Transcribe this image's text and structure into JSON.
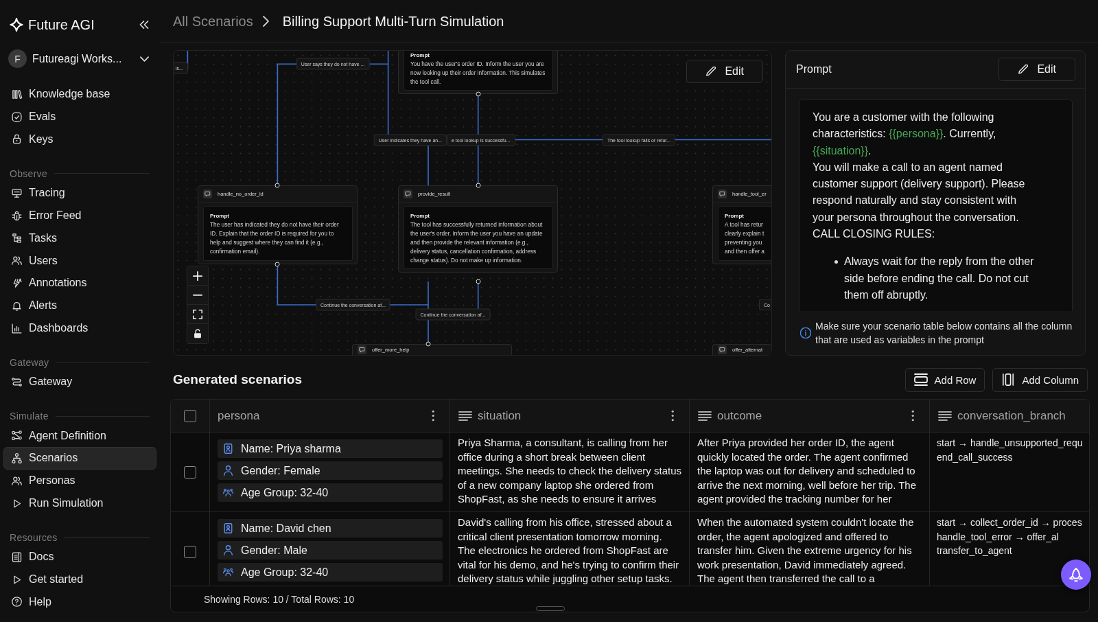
{
  "sidebar": {
    "brand": "Future AGI",
    "workspace": {
      "avatar_letter": "F",
      "name": "Futureagi Works..."
    },
    "top_items": [
      {
        "label": "Knowledge base",
        "selected": false
      },
      {
        "label": "Evals",
        "selected": false
      },
      {
        "label": "Keys",
        "selected": false
      }
    ],
    "sections": [
      {
        "title": "Observe",
        "items": [
          {
            "label": "Tracing",
            "selected": false
          },
          {
            "label": "Error Feed",
            "selected": false
          },
          {
            "label": "Tasks",
            "selected": false
          },
          {
            "label": "Users",
            "selected": false
          },
          {
            "label": "Annotations",
            "selected": false
          },
          {
            "label": "Alerts",
            "selected": false
          },
          {
            "label": "Dashboards",
            "selected": false
          }
        ]
      },
      {
        "title": "Gateway",
        "items": [
          {
            "label": "Gateway",
            "selected": false
          }
        ]
      },
      {
        "title": "Simulate",
        "items": [
          {
            "label": "Agent Definition",
            "selected": false
          },
          {
            "label": "Scenarios",
            "selected": true
          },
          {
            "label": "Personas",
            "selected": false
          },
          {
            "label": "Run Simulation",
            "selected": false
          }
        ]
      },
      {
        "title": "Resources",
        "items": [
          {
            "label": "Docs",
            "selected": false
          },
          {
            "label": "Get started",
            "selected": false
          },
          {
            "label": "Help",
            "selected": false
          }
        ]
      }
    ]
  },
  "breadcrumb": [
    {
      "label": "All Scenarios",
      "current": false
    },
    {
      "label": "Billing Support Multi-Turn Simulation",
      "current": true
    }
  ],
  "flow": {
    "edit_label": "Edit",
    "nodes": [
      {
        "prompt_label": "Prompt",
        "prompt": "You have the user's order ID. Inform the user you are now looking up their order information. This simulates the tool call."
      },
      {
        "title": "handle_no_order_id",
        "prompt_label": "Prompt",
        "prompt": "The user has indicated they do not have their order ID. Explain that the order ID is required for you to help and suggest where they can find it (e.g., confirmation email)."
      },
      {
        "title": "provide_result",
        "prompt_label": "Prompt",
        "prompt": "The tool has successfully returned information about the user's order. Inform the user you have an update and then provide the relevant information (e.g., delivery status, cancellation confirmation, address change status). Do not make up information."
      },
      {
        "title": "handle_tool_er",
        "prompt_label": "Prompt",
        "prompt": "A tool has retur\nclearly explain t\npreventing you\nand then offer a"
      },
      {
        "title": "offer_more_help"
      },
      {
        "title": "offer_alternat"
      }
    ],
    "edge_labels": [
      "is...",
      "User says they do not have ...",
      "User indicates they have an...",
      "e tool lookup is successfu...",
      "The tool lookup fails or retur...",
      "Continue the conversation af...",
      "Continue the conversation af...",
      "Co"
    ]
  },
  "prompt_panel": {
    "title": "Prompt",
    "edit_label": "Edit",
    "paragraphs": [
      {
        "segments": [
          {
            "kind": "text",
            "text": "You are a customer with the following characteristics: "
          },
          {
            "kind": "variable",
            "text": "{{persona}}"
          },
          {
            "kind": "text",
            "text": ". Currently, "
          },
          {
            "kind": "variable",
            "text": "{{situation}}"
          },
          {
            "kind": "text",
            "text": "."
          }
        ]
      },
      {
        "segments": [
          {
            "kind": "text",
            "text": "You will make a call to an agent named customer support (delivery support). Please respond naturally and stay consistent with your persona throughout the conversation."
          }
        ]
      },
      {
        "segments": [
          {
            "kind": "text",
            "text": "CALL CLOSING RULES:"
          }
        ]
      }
    ],
    "bullets": [
      "Always wait for the reply from the other side before ending the call. Do not cut them off abruptly."
    ],
    "note": "Make sure your scenario table below contains all the column that are used as variables in the prompt"
  },
  "scenarios": {
    "title": "Generated scenarios",
    "actions": [
      "Add Row",
      "Add Column"
    ],
    "table": {
      "all_selected": false,
      "columns": [
        {
          "label": "persona",
          "kind": "persona",
          "menu": true
        },
        {
          "label": "situation",
          "kind": "text",
          "menu": true
        },
        {
          "label": "outcome",
          "kind": "text",
          "menu": true
        },
        {
          "label": "conversation_branch",
          "kind": "text",
          "menu": false
        }
      ],
      "rows": [
        {
          "selected": false,
          "cells": [
            [
              "Name: Priya sharma",
              "Gender: Female",
              "Age Group: 32-40"
            ],
            "Priya Sharma, a consultant, is calling from her office during a short break between client meetings. She needs to check the delivery status of a new company laptop she ordered from ShopFast, as she needs to ensure it arrives",
            "After Priya provided her order ID, the agent quickly located the order. The agent confirmed the laptop was out for delivery and scheduled to arrive the next morning, well before her trip. The agent provided the tracking number for her",
            "start → handle_unsupported_requ\nend_call_success"
          ]
        },
        {
          "selected": false,
          "cells": [
            [
              "Name: David chen",
              "Gender: Male",
              "Age Group: 32-40"
            ],
            "David's calling from his office, stressed about a critical client presentation tomorrow morning. The electronics he ordered from ShopFast are vital for his demo, and he's trying to confirm their delivery status while juggling other setup tasks.",
            "When the automated system couldn't locate the order, the agent apologized and offered to transfer him. Given the extreme urgency for his work presentation, David immediately agreed. The agent then transferred the call to a",
            "start → collect_order_id → proces\nhandle_tool_error → offer_al\ntransfer_to_agent"
          ]
        }
      ],
      "footer": "Showing Rows: 10 / Total Rows: 10"
    }
  }
}
